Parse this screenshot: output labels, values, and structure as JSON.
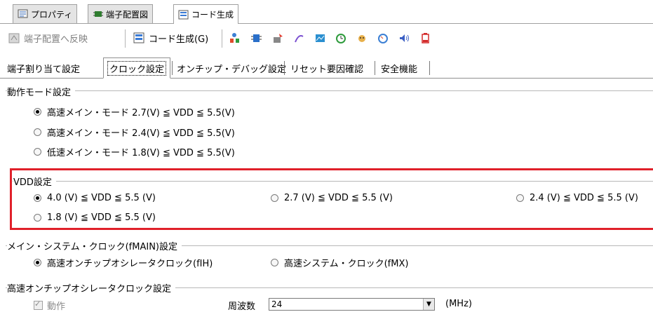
{
  "doc_tabs": [
    {
      "label": "プロパティ",
      "icon": "properties-icon",
      "active": false
    },
    {
      "label": "端子配置図",
      "icon": "pin-diagram-icon",
      "active": false
    },
    {
      "label": "コード生成",
      "icon": "code-generate-icon",
      "active": true
    }
  ],
  "toolbar": {
    "map_to_pins_label": "端子配置へ反映",
    "code_generate_label": "コード生成(G)",
    "icons": [
      "clock-tree-icon",
      "port-icon",
      "interrupt-icon",
      "serial-icon",
      "adc-icon",
      "timer-icon",
      "watchdog-icon",
      "rtc-icon",
      "sound-icon",
      "battery-icon"
    ]
  },
  "inner_tabs": [
    "端子割り当て設定",
    "クロック設定",
    "オンチップ・デバッグ設定",
    "リセット要因確認",
    "安全機能"
  ],
  "inner_tab_active": "クロック設定",
  "operation_mode": {
    "title": "動作モード設定",
    "options": [
      {
        "label": "高速メイン・モード 2.7(V) ≦ VDD ≦ 5.5(V)",
        "selected": true
      },
      {
        "label": "高速メイン・モード 2.4(V) ≦ VDD ≦ 5.5(V)",
        "selected": false
      },
      {
        "label": "低速メイン・モード 1.8(V) ≦ VDD ≦ 5.5(V)",
        "selected": false
      }
    ]
  },
  "vdd": {
    "title": "VDD設定",
    "options": [
      {
        "label": "4.0 (V) ≦ VDD ≦ 5.5 (V)",
        "selected": true
      },
      {
        "label": "2.7 (V) ≦ VDD ≦ 5.5 (V)",
        "selected": false
      },
      {
        "label": "2.4 (V) ≦ VDD ≦ 5.5 (V)",
        "selected": false
      },
      {
        "label": "1.8 (V) ≦ VDD ≦ 5.5 (V)",
        "selected": false
      }
    ],
    "highlight_color": "#e0202a"
  },
  "main_clock": {
    "title": "メイン・システム・クロック(fMAIN)設定",
    "options": [
      {
        "label": "高速オンチップオシレータクロック(fIH)",
        "selected": true
      },
      {
        "label": "高速システム・クロック(fMX)",
        "selected": false
      }
    ]
  },
  "hoco": {
    "title": "高速オンチップオシレータクロック設定",
    "operation_label": "動作",
    "operation_checked": true,
    "frequency_label": "周波数",
    "frequency_value": "24",
    "unit": "(MHz)"
  }
}
